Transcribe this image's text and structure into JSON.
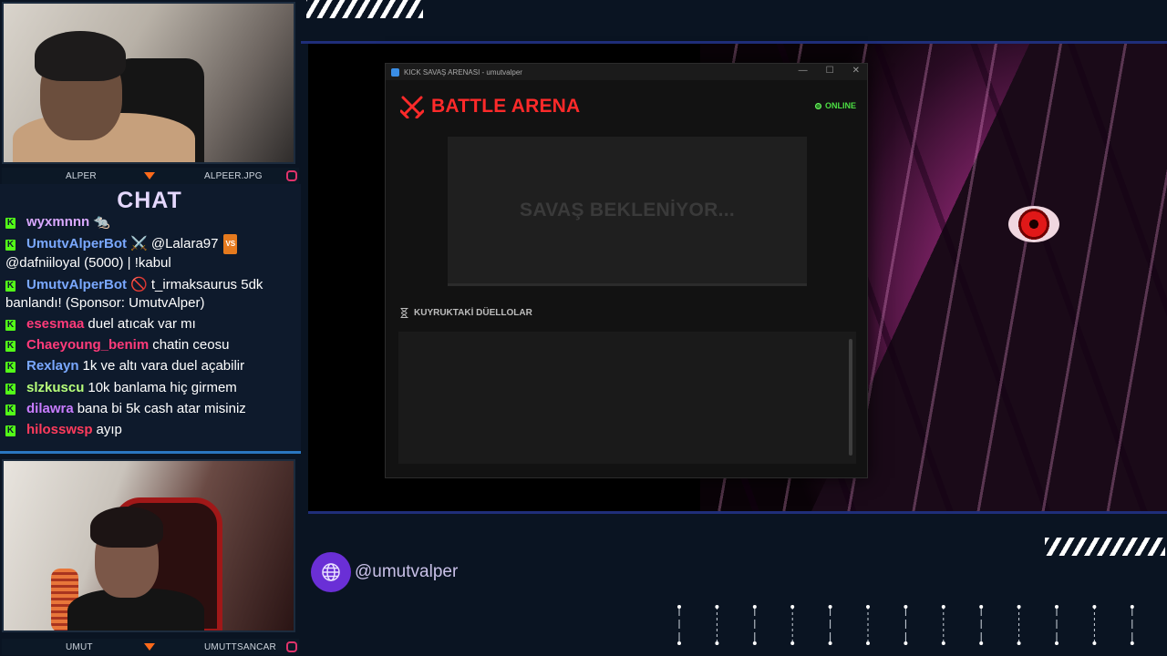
{
  "cams": {
    "top": {
      "left_name": "ALPER",
      "right_name": "ALPEER.JPG"
    },
    "bottom": {
      "left_name": "UMUT",
      "right_name": "UMUTTSANCAR"
    }
  },
  "chat": {
    "title": "CHAT",
    "messages": [
      {
        "user": "wyxmnnn",
        "color": "#d9a8ff",
        "text": "🐀"
      },
      {
        "user": "UmutvAlperBot",
        "color": "#7aa8ff",
        "text": "⚔️ @Lalara97",
        "badge": "VS",
        "text2": "@dafniiloyal (5000) | !kabul"
      },
      {
        "user": "UmutvAlperBot",
        "color": "#7aa8ff",
        "text": "🚫 t_irmaksaurus 5dk banlandı! (Sponsor: UmutvAlper)"
      },
      {
        "user": "esesmaa",
        "color": "#ff3b7a",
        "text": "duel atıcak var mı"
      },
      {
        "user": "Chaeyoung_benim",
        "color": "#ff3b7a",
        "text": "chatin ceosu"
      },
      {
        "user": "Rexlayn",
        "color": "#7aa8ff",
        "text": "1k ve altı vara duel açabilir"
      },
      {
        "user": "slzkuscu",
        "color": "#b7ff7a",
        "text": "10k banlama hiç girmem"
      },
      {
        "user": "dilawra",
        "color": "#c87cff",
        "text": "bana bi 5k cash atar misiniz"
      },
      {
        "user": "hilosswsp",
        "color": "#ff3b5c",
        "text": "ayıp"
      }
    ]
  },
  "window": {
    "title": "KICK SAVAŞ ARENASI - umutvalper",
    "controls": [
      "—",
      "☐",
      "✕"
    ],
    "arena_title": "BATTLE ARENA",
    "status": "ONLINE",
    "battle_text": "SAVAŞ BEKLENİYOR...",
    "queue_title": "KUYRUKTAKİ DÜELLOLAR"
  },
  "social": {
    "handle": "@umutvalper"
  },
  "colors": {
    "accent_red": "#ff2a2a",
    "online_green": "#4cdf43",
    "kick_green": "#53fc18",
    "purple": "#6a2fd6"
  }
}
